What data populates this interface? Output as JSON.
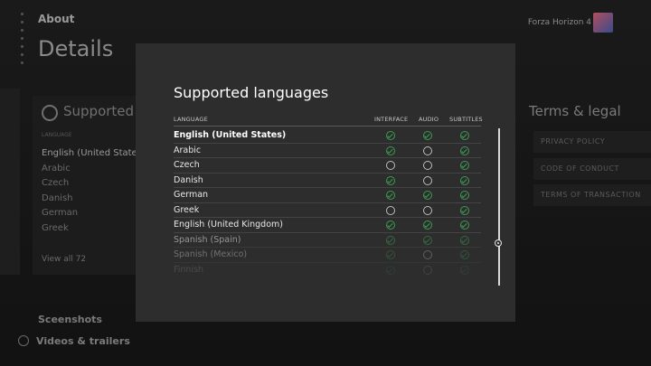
{
  "background": {
    "section_label": "About",
    "page_title": "Details",
    "user_name": "Forza Horizon 4",
    "languages_card": {
      "title": "Supported la",
      "subtitle": "LANGUAGE",
      "items": [
        "English (United States)",
        "Arabic",
        "Czech",
        "Danish",
        "German",
        "Greek"
      ],
      "view_all": "View all 72"
    },
    "terms": {
      "title": "Terms & legal",
      "links": [
        "PRIVACY POLICY",
        "CODE OF CONDUCT",
        "TERMS OF TRANSACTION"
      ]
    },
    "screenshots_label": "Sceenshots",
    "videos_label": "Videos & trailers"
  },
  "dialog": {
    "title": "Supported languages",
    "columns": {
      "language": "LANGUAGE",
      "interface": "INTERFACE",
      "audio": "AUDIO",
      "subtitles": "SUBTITLES"
    },
    "rows": [
      {
        "language": "English (United States)",
        "interface": true,
        "audio": true,
        "subtitles": true,
        "emphasis": "bold"
      },
      {
        "language": "Arabic",
        "interface": true,
        "audio": false,
        "subtitles": true
      },
      {
        "language": "Czech",
        "interface": false,
        "audio": false,
        "subtitles": true
      },
      {
        "language": "Danish",
        "interface": true,
        "audio": false,
        "subtitles": true
      },
      {
        "language": "German",
        "interface": true,
        "audio": true,
        "subtitles": true
      },
      {
        "language": "Greek",
        "interface": false,
        "audio": false,
        "subtitles": true
      },
      {
        "language": "English (United Kingdom)",
        "interface": true,
        "audio": true,
        "subtitles": true
      },
      {
        "language": "Spanish (Spain)",
        "interface": true,
        "audio": true,
        "subtitles": true,
        "fade": "f1"
      },
      {
        "language": "Spanish (Mexico)",
        "interface": true,
        "audio": false,
        "subtitles": true,
        "fade": "f2"
      },
      {
        "language": "Finnish",
        "interface": true,
        "audio": false,
        "subtitles": true,
        "fade": "f3"
      }
    ],
    "scroll_position": 0.73
  },
  "colors": {
    "check_green": "#3c9b52",
    "dialog_bg": "#2d2d2e",
    "page_bg": "#141414"
  },
  "icons": {
    "check": "circle-check-icon",
    "unsupported": "empty-circle-icon",
    "globe": "globe-icon"
  }
}
